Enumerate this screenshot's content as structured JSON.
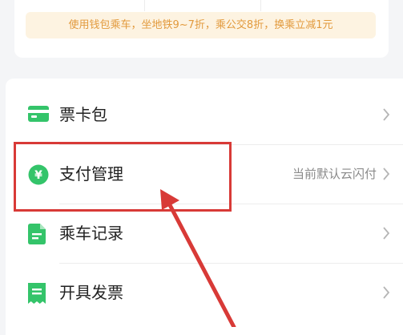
{
  "promo": {
    "text": "使用钱包乘车，坐地铁9~7折，乘公交8折，换乘立减1元"
  },
  "menu": {
    "items": [
      {
        "label": "票卡包",
        "value": "",
        "icon": "card-icon"
      },
      {
        "label": "支付管理",
        "value": "当前默认云闪付",
        "icon": "yen-icon"
      },
      {
        "label": "乘车记录",
        "value": "",
        "icon": "record-icon"
      },
      {
        "label": "开具发票",
        "value": "",
        "icon": "receipt-icon"
      }
    ]
  },
  "colors": {
    "accent_green": "#34c46a",
    "promo_bg": "#fdf3e1",
    "promo_text": "#e29a3d",
    "annotation_red": "#d83a37"
  }
}
